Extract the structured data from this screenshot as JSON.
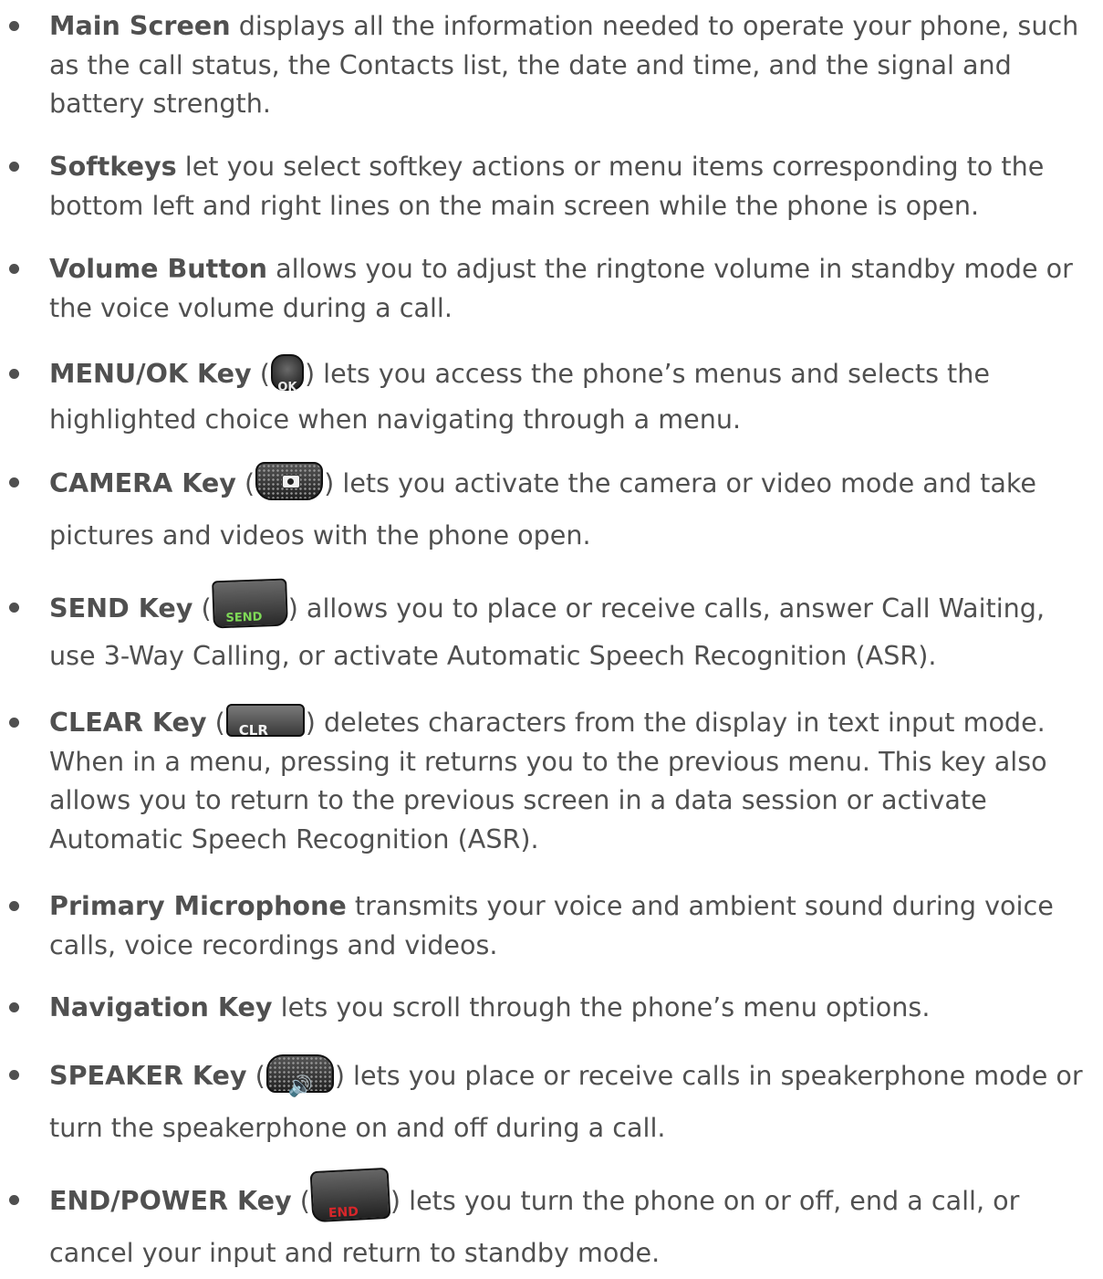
{
  "items": [
    {
      "term": "Main Screen",
      "text": "displays all the information needed to operate your phone, such as the call status, the Contacts list, the date and time, and the signal and battery strength."
    },
    {
      "term": "Softkeys",
      "text": "let you select softkey actions or menu items corresponding to the bottom left and right lines on the main screen while the phone is open."
    },
    {
      "term": "Volume Button",
      "text": "allows you to adjust the ringtone volume in standby mode or the voice volume during a call."
    },
    {
      "term": "MENU/OK Key",
      "icon": "ok-key-icon",
      "icon_label": "OK",
      "text": ") lets you access the phone’s menus and selects the highlighted choice when navigating through a menu."
    },
    {
      "term": "CAMERA Key",
      "icon": "camera-key-icon",
      "text": ") lets you activate the camera or video mode and take pictures and videos with the phone open."
    },
    {
      "term": "SEND Key",
      "icon": "send-key-icon",
      "icon_label": "SEND",
      "text": ") allows you to place or receive calls, answer Call Waiting, use 3-Way Calling, or activate Automatic Speech Recognition (ASR)."
    },
    {
      "term": "CLEAR Key",
      "icon": "clear-key-icon",
      "icon_label": "CLR",
      "text": ") deletes characters from the display in text input mode. When in a menu, pressing it returns you to the previous menu. This key also allows you to return to the previous screen in a data session or activate Automatic Speech Recognition (ASR)."
    },
    {
      "term": "Primary Microphone",
      "text": "transmits your voice and ambient sound during voice calls, voice recordings and videos."
    },
    {
      "term": "Navigation Key",
      "text": "lets you scroll through the phone’s menu options."
    },
    {
      "term": "SPEAKER Key",
      "icon": "speaker-key-icon",
      "text": ") lets you place or receive calls in speakerphone mode or turn the speakerphone on and off during a call."
    },
    {
      "term": "END/POWER Key",
      "icon": "end-power-key-icon",
      "icon_label": "END",
      "text": ") lets you turn the phone on or off, end a call, or cancel your input and return to standby mode."
    }
  ],
  "open_paren": "("
}
